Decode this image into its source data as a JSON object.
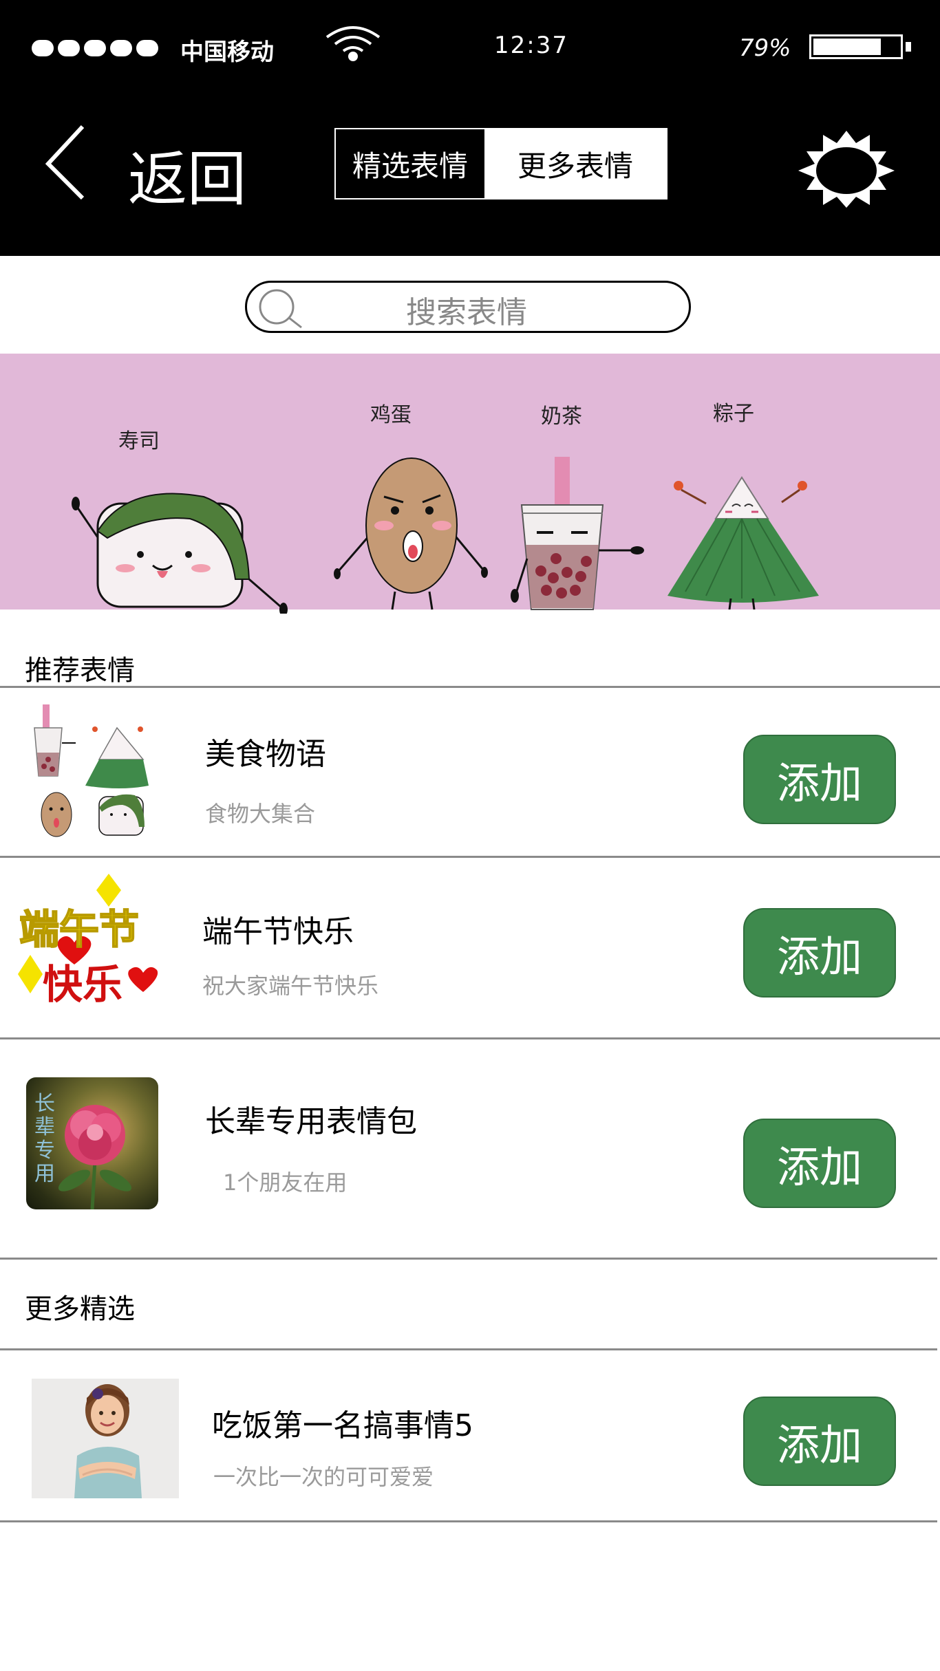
{
  "status_bar": {
    "carrier": "中国移动",
    "time": "12:37",
    "battery_pct": "79%",
    "battery_level": 0.79
  },
  "nav": {
    "back_label": "返回",
    "tabs": [
      {
        "label": "精选表情",
        "selected": false
      },
      {
        "label": "更多表情",
        "selected": true
      }
    ],
    "settings_icon": "gear-icon"
  },
  "search": {
    "placeholder": "搜索表情"
  },
  "banner": {
    "characters": [
      {
        "label": "寿司",
        "icon": "sushi-icon"
      },
      {
        "label": "鸡蛋",
        "icon": "egg-icon"
      },
      {
        "label": "奶茶",
        "icon": "milk-tea-icon"
      },
      {
        "label": "粽子",
        "icon": "zongzi-icon"
      }
    ]
  },
  "recommended": {
    "title": "推荐表情",
    "items": [
      {
        "title": "美食物语",
        "subtitle": "食物大集合",
        "button": "添加"
      },
      {
        "title": "端午节快乐",
        "subtitle": "祝大家端午节快乐",
        "button": "添加",
        "thumb_text": [
          "端午节",
          "快乐"
        ]
      },
      {
        "title": "长辈专用表情包",
        "subtitle": "1个朋友在用",
        "button": "添加",
        "thumb_text": "长辈专用"
      }
    ]
  },
  "more": {
    "title": "更多精选",
    "items": [
      {
        "title": "吃饭第一名搞事情5",
        "subtitle": "一次比一次的可可爱爱",
        "button": "添加"
      }
    ]
  },
  "colors": {
    "header_bg": "#000000",
    "banner_bg": "#e1b8d8",
    "button_green": "#3e8a4d",
    "divider": "#8a8a8a"
  }
}
